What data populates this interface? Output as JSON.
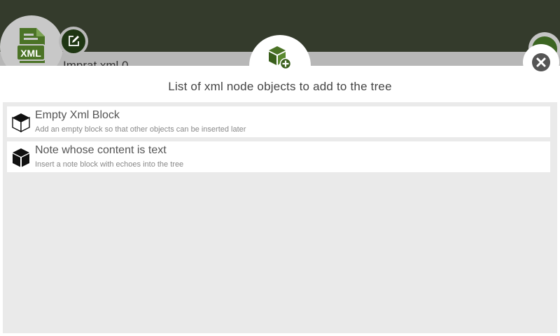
{
  "background": {
    "file_icon_text": "XML",
    "document_title": "Imprat xml 0"
  },
  "modal": {
    "title": "List of xml node objects to add to the tree",
    "header_icon": "cube-add-icon",
    "close_icon": "close-icon",
    "items": [
      {
        "title": "Empty Xml Block",
        "description": "Add an empty block so that other objects can be inserted later",
        "icon": "cube-outline-icon"
      },
      {
        "title": "Note whose content is text",
        "description": "Insert a note block with echoes into the tree",
        "icon": "cube-filled-icon"
      }
    ]
  },
  "colors": {
    "app_bar": "#343b2c",
    "accent_green": "#3c6522",
    "modal_bg": "#ffffff",
    "list_bg": "#eaeaea"
  }
}
